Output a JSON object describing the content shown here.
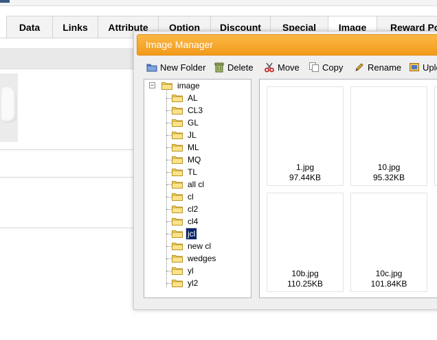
{
  "tabs": [
    "Data",
    "Links",
    "Attribute",
    "Option",
    "Discount",
    "Special",
    "Image",
    "Reward Po"
  ],
  "active_tab": "Image",
  "dialog": {
    "title": "Image Manager",
    "toolbar": {
      "new_folder": "New Folder",
      "delete": "Delete",
      "move": "Move",
      "copy": "Copy",
      "rename": "Rename",
      "upload": "Uplo"
    },
    "tree": {
      "root": "image",
      "folders": [
        "AL",
        "CL3",
        "GL",
        "JL",
        "ML",
        "MQ",
        "TL",
        "all cl",
        "cl",
        "cl2",
        "cl4",
        "jcl",
        "new cl",
        "wedges",
        "yl",
        "yl2"
      ],
      "selected": "jcl"
    },
    "files": [
      {
        "name": "1.jpg",
        "size": "97.44KB"
      },
      {
        "name": "10.jpg",
        "size": "95.32KB"
      },
      {
        "name": "10b.jpg",
        "size": "110.25KB"
      },
      {
        "name": "10c.jpg",
        "size": "101.84KB"
      }
    ]
  },
  "colors": {
    "titlebar": "#f5a623",
    "selection": "#0a246a"
  },
  "icons": {
    "new_folder": "folder-icon",
    "delete": "trash-icon",
    "move": "scissors-icon",
    "copy": "copy-icon",
    "rename": "pencil-icon",
    "upload": "upload-icon"
  }
}
